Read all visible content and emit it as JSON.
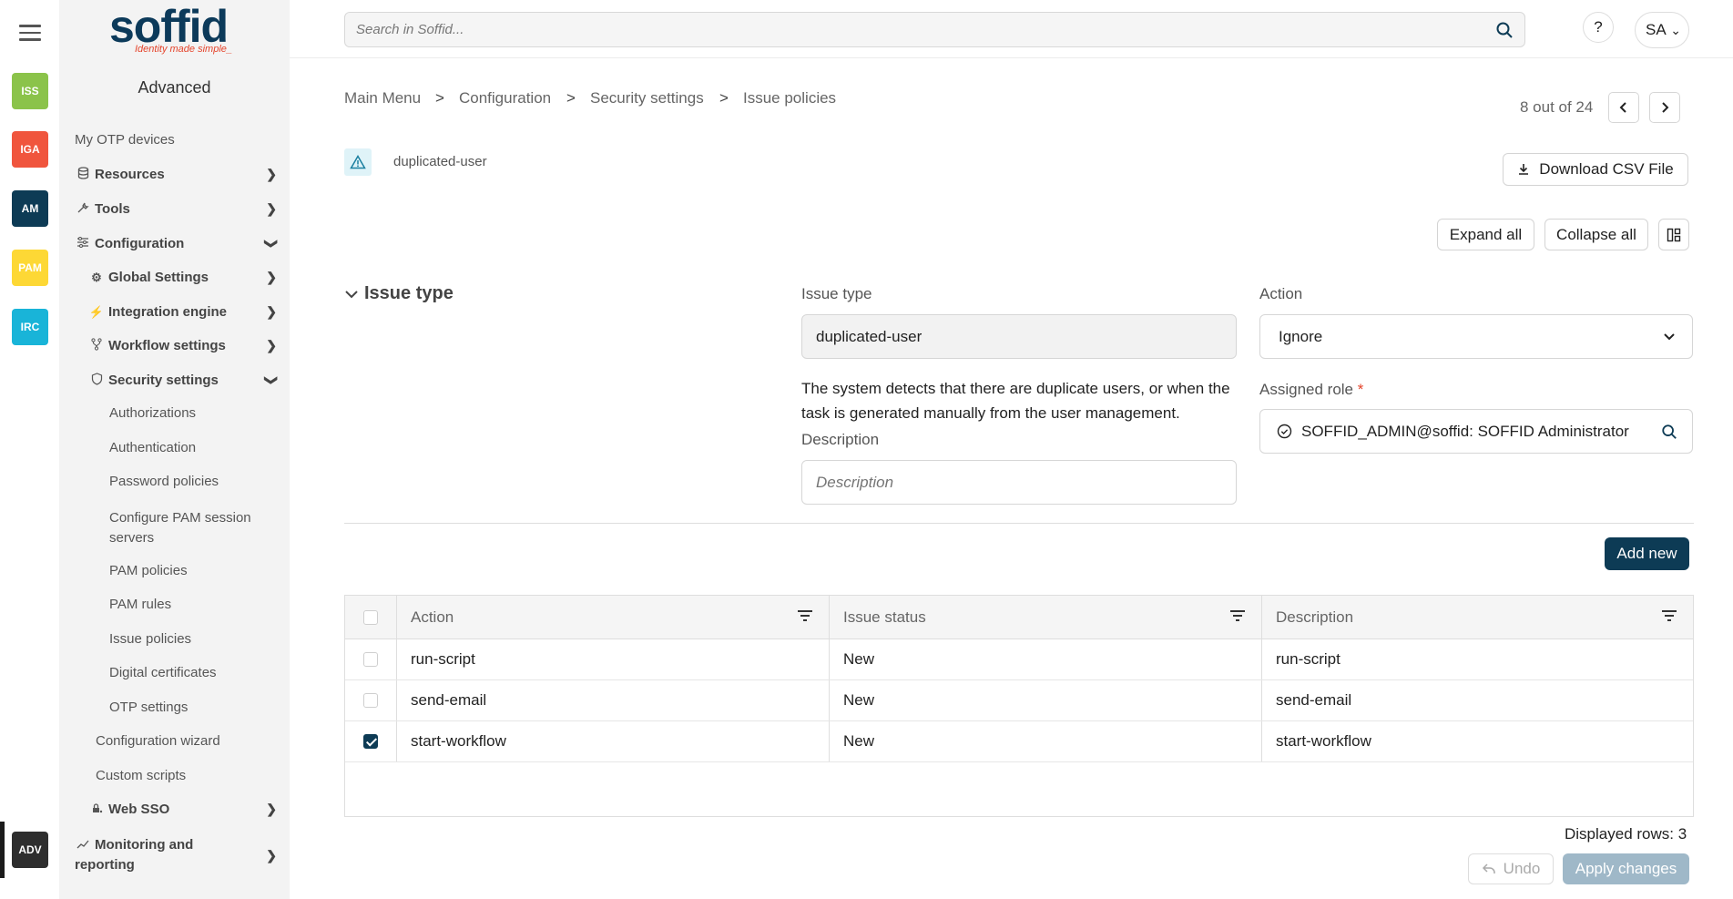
{
  "rail": {
    "tiles": [
      {
        "label": "ISS",
        "color": "#8bc34a"
      },
      {
        "label": "IGA",
        "color": "#f0553d"
      },
      {
        "label": "AM",
        "color": "#0d3b55"
      },
      {
        "label": "PAM",
        "color": "#fdd835"
      },
      {
        "label": "IRC",
        "color": "#19b4d8"
      },
      {
        "label": "ADV",
        "color": "#2e2e2e"
      }
    ]
  },
  "logo": {
    "word": "soffid",
    "tagline": "Identity made simple_"
  },
  "sidebar": {
    "title": "Advanced",
    "items": {
      "otp_devices": "My OTP devices",
      "resources": "Resources",
      "tools": "Tools",
      "configuration": "Configuration",
      "global_settings": "Global Settings",
      "integration_engine": "Integration engine",
      "workflow_settings": "Workflow settings",
      "security_settings": "Security settings",
      "authorizations": "Authorizations",
      "authentication": "Authentication",
      "password_policies": "Password policies",
      "configure_pam_line1": "Configure PAM session",
      "configure_pam_line2": "servers",
      "pam_policies": "PAM policies",
      "pam_rules": "PAM rules",
      "issue_policies": "Issue policies",
      "digital_certificates": "Digital certificates",
      "otp_settings": "OTP settings",
      "configuration_wizard": "Configuration wizard",
      "custom_scripts": "Custom scripts",
      "web_sso": "Web SSO",
      "monitoring_line1": "Monitoring and",
      "monitoring_line2": "reporting"
    }
  },
  "topbar": {
    "search_placeholder": "Search in Soffid...",
    "help": "?",
    "user_initials": "SA"
  },
  "breadcrumb": {
    "items": [
      "Main Menu",
      "Configuration",
      "Security settings",
      "Issue policies"
    ],
    "separator": ">"
  },
  "pager": {
    "text": "8 out of 24"
  },
  "object": {
    "name": "duplicated-user"
  },
  "buttons": {
    "download_csv": "Download CSV File",
    "expand_all": "Expand all",
    "collapse_all": "Collapse all",
    "add_new": "Add new",
    "undo": "Undo",
    "apply_changes": "Apply changes"
  },
  "section": {
    "title": "Issue type"
  },
  "form": {
    "issue_type_label": "Issue type",
    "issue_type_value": "duplicated-user",
    "issue_type_description": "The system detects that there are duplicate users, or when the task is generated manually from the user management.",
    "description_label": "Description",
    "description_placeholder": "Description",
    "action_label": "Action",
    "action_value": "Ignore",
    "assigned_role_label": "Assigned role",
    "assigned_role_required": "*",
    "assigned_role_value": "SOFFID_ADMIN@soffid: SOFFID Administrator"
  },
  "table": {
    "columns": [
      "Action",
      "Issue status",
      "Description"
    ],
    "rows": [
      {
        "checked": false,
        "action": "run-script",
        "status": "New",
        "description": "run-script"
      },
      {
        "checked": false,
        "action": "send-email",
        "status": "New",
        "description": "send-email"
      },
      {
        "checked": true,
        "action": "start-workflow",
        "status": "New",
        "description": "start-workflow"
      }
    ],
    "displayed_rows": "Displayed rows: 3"
  },
  "colors": {
    "primary": "#0d3b55",
    "accent": "#e5442b",
    "disabled_primary": "#9fb8c8"
  }
}
